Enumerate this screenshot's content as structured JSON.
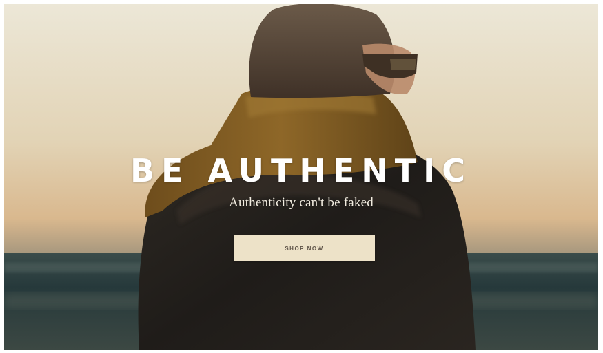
{
  "hero": {
    "title": "BE AUTHENTIC",
    "subtitle": "Authenticity can't be faked",
    "cta_label": "SHOP NOW",
    "image_alt": "",
    "colors": {
      "sky_top": "#e9e4d2",
      "sky_bottom": "#d9b98e",
      "sea": "#26393b",
      "jacket": "#23201d",
      "scarf": "#8b6424",
      "button_bg": "#ede2c8",
      "title_text": "#ffffff"
    }
  }
}
